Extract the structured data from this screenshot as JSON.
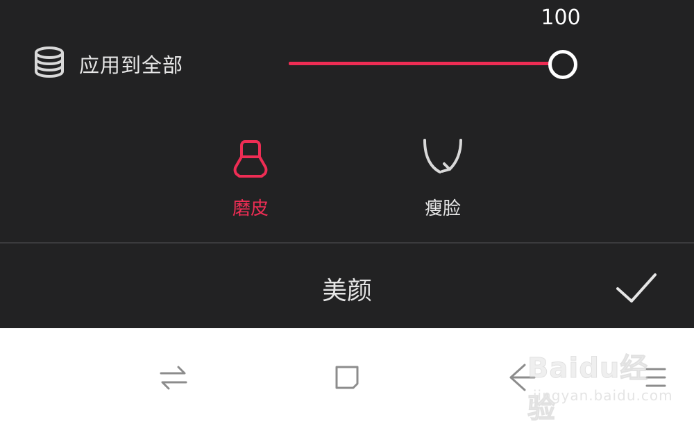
{
  "editor": {
    "apply_all_label": "应用到全部",
    "apply_all_icon": "layers-stack-icon",
    "slider": {
      "value_text": "100",
      "value": 100,
      "max": 100
    },
    "tools": [
      {
        "label": "磨皮",
        "icon": "skin-smooth-icon",
        "active": true
      },
      {
        "label": "瘦脸",
        "icon": "face-slim-icon",
        "active": false
      }
    ],
    "bottom_title": "美颜",
    "confirm_icon": "check-icon"
  },
  "colors": {
    "accent": "#ee2d54",
    "panel_bg": "#222223",
    "text": "#e6e6e6"
  },
  "navbar": {
    "icons": [
      "swap-arrows-icon",
      "square-icon",
      "back-arrow-icon",
      "menu-icon"
    ]
  },
  "watermark": {
    "logo": "Baidu经验",
    "url": "jingyan.baidu.com"
  }
}
